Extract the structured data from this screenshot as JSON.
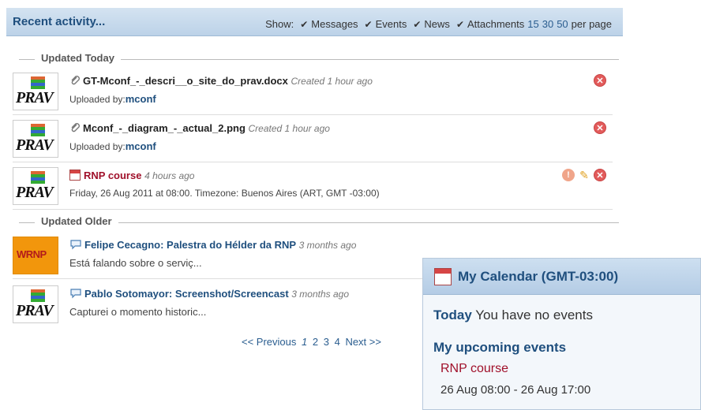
{
  "recent": {
    "title": "Recent activity...",
    "show_label": "Show:",
    "filters": [
      "Messages",
      "Events",
      "News",
      "Attachments"
    ],
    "per_page_options": [
      "15",
      "30",
      "50"
    ],
    "per_page_label": "per page"
  },
  "sections": {
    "today": "Updated Today",
    "older": "Updated Older"
  },
  "items": [
    {
      "logo": "PRAV",
      "title": "GT-Mconf_-_descri__o_site_do_prav.docx",
      "time": "Created 1 hour ago",
      "by_label": "Uploaded by:",
      "by_user": "mconf"
    },
    {
      "logo": "PRAV",
      "title": "Mconf_-_diagram_-_actual_2.png",
      "time": "Created 1 hour ago",
      "by_label": "Uploaded by:",
      "by_user": "mconf"
    },
    {
      "logo": "PRAV",
      "title": "RNP course",
      "time": "4 hours ago",
      "detail": "Friday, 26 Aug 2011 at 08:00. Timezone: Buenos Aires (ART, GMT -03:00)"
    },
    {
      "logo": "WRNP",
      "author": "Felipe Cecagno:",
      "title": "Palestra do Hélder da RNP",
      "time": "3 months ago",
      "detail": "Está falando sobre o serviç..."
    },
    {
      "logo": "PRAV",
      "author": "Pablo Sotomayor:",
      "title": "Screenshot/Screencast",
      "time": "3 months ago",
      "detail": "Capturei o momento historic..."
    }
  ],
  "pagination": {
    "prev": "<< Previous",
    "pages": [
      "1",
      "2",
      "3",
      "4"
    ],
    "next": "Next >>"
  },
  "calendar": {
    "title": "My Calendar (GMT-03:00)",
    "today_label": "Today",
    "today_text": "You have no events",
    "upcoming_label": "My upcoming events",
    "event_title": "RNP course",
    "event_range": "26 Aug 08:00 - 26 Aug 17:00"
  },
  "colors": {
    "accent": "#1f4f7e",
    "event": "#a0102a",
    "delete": "#e25b5b"
  }
}
